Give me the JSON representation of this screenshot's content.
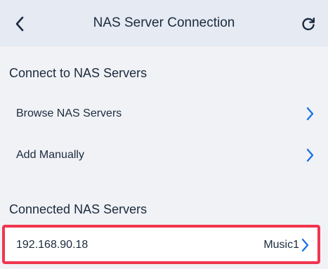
{
  "header": {
    "title": "NAS Server Connection",
    "back_icon": "chevron-left-icon",
    "refresh_icon": "refresh-icon"
  },
  "connect_section": {
    "title": "Connect to NAS Servers",
    "items": [
      {
        "label": "Browse NAS Servers",
        "icon": "chevron-right-icon"
      },
      {
        "label": "Add Manually",
        "icon": "chevron-right-icon"
      }
    ]
  },
  "connected_section": {
    "title": "Connected NAS Servers",
    "servers": [
      {
        "address": "192.168.90.18",
        "share": "Music1",
        "icon": "chevron-right-icon"
      }
    ]
  },
  "colors": {
    "accent": "#1a73e8",
    "highlight_border": "#f0364f",
    "header_bg": "#e5eaf3",
    "page_bg": "#f1f2f6"
  }
}
